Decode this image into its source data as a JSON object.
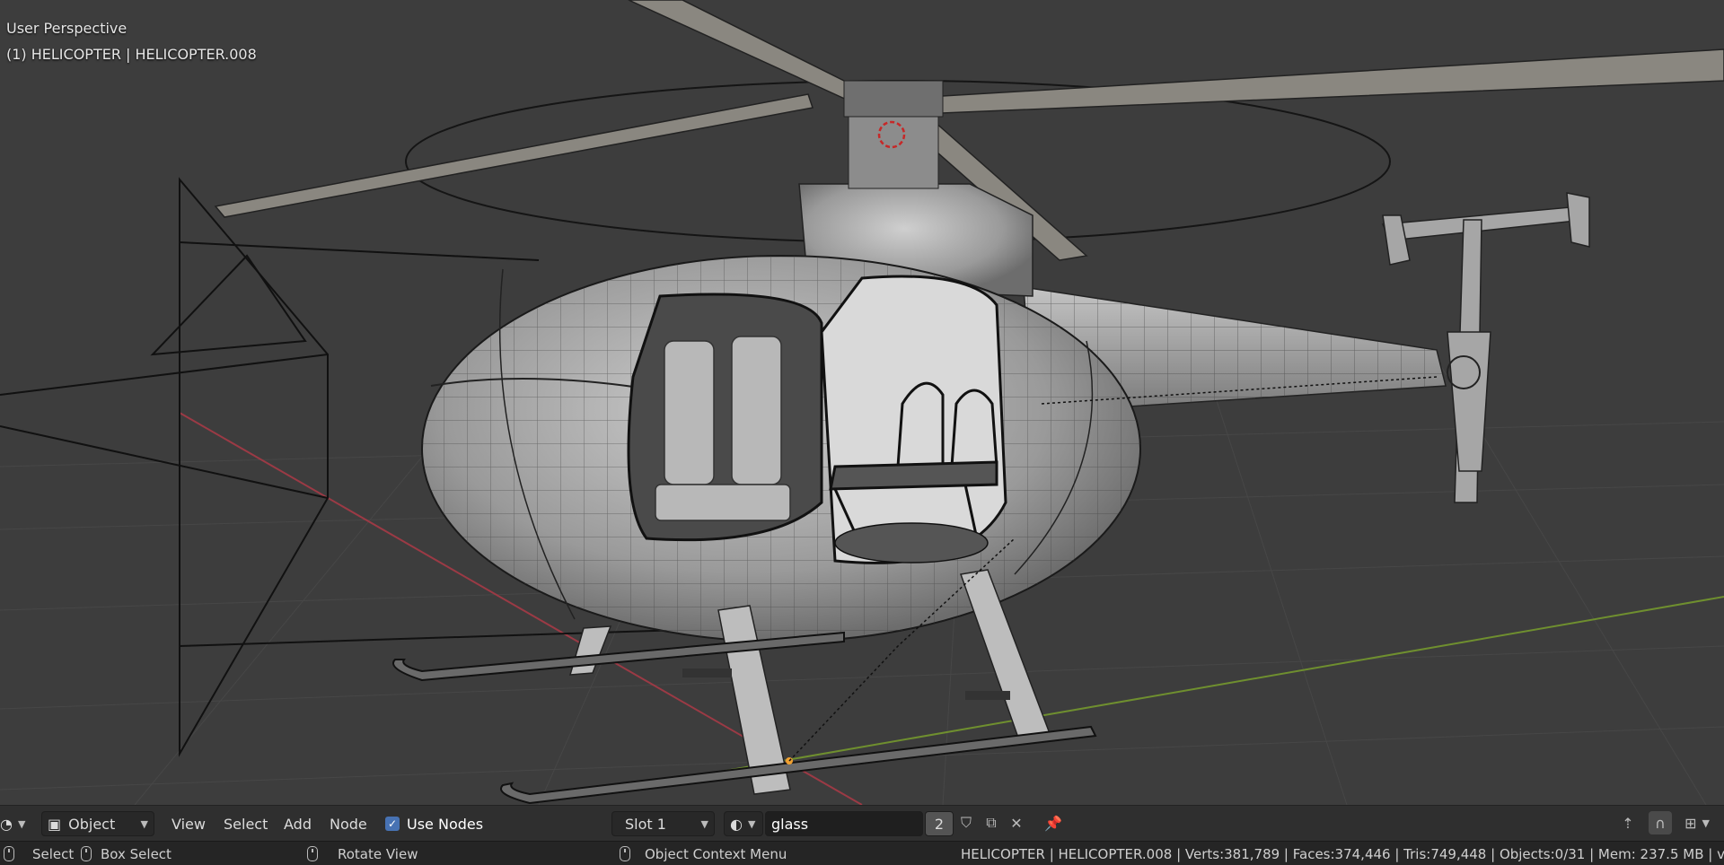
{
  "viewport": {
    "perspective_label": "User Perspective",
    "object_label": "(1) HELICOPTER | HELICOPTER.008"
  },
  "header": {
    "editor_icon": "node-editor-icon",
    "mode_label": "Object",
    "menus": [
      "View",
      "Select",
      "Add",
      "Node"
    ],
    "use_nodes_label": "Use Nodes",
    "use_nodes_checked": true,
    "slot_label": "Slot 1",
    "material_name": "glass",
    "user_count": "2"
  },
  "status": {
    "select_label": "Select",
    "box_select_label": "Box Select",
    "rotate_view_label": "Rotate View",
    "context_menu_label": "Object Context Menu",
    "stats": "HELICOPTER | HELICOPTER.008 | Verts:381,789 | Faces:374,446 | Tris:749,448 | Objects:0/31 | Mem: 237.5 MB | v"
  },
  "colors": {
    "accent": "#4772b3",
    "x_axis": "#9b3a45",
    "y_axis": "#6f8f2f"
  }
}
